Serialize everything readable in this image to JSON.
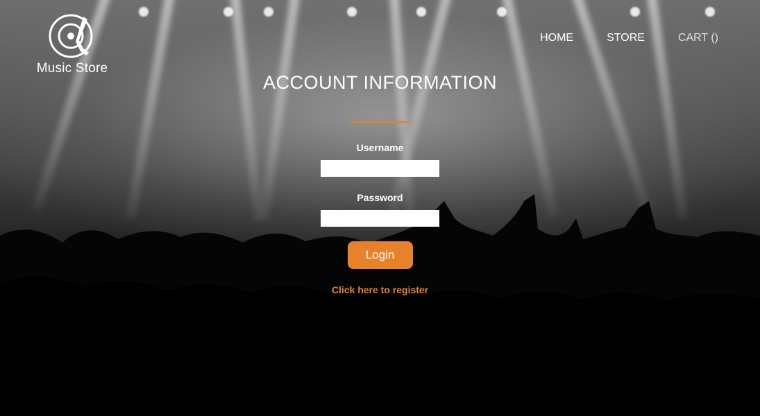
{
  "brand": {
    "name": "Music Store"
  },
  "nav": {
    "home": "HOME",
    "store": "STORE",
    "cart": "CART ()"
  },
  "form": {
    "title": "ACCOUNT INFORMATION",
    "username_label": "Username",
    "username_value": "",
    "password_label": "Password",
    "password_value": "",
    "login_label": "Login",
    "register_link": "Click here to register"
  },
  "colors": {
    "accent": "#e7822a",
    "text": "#ffffff"
  }
}
